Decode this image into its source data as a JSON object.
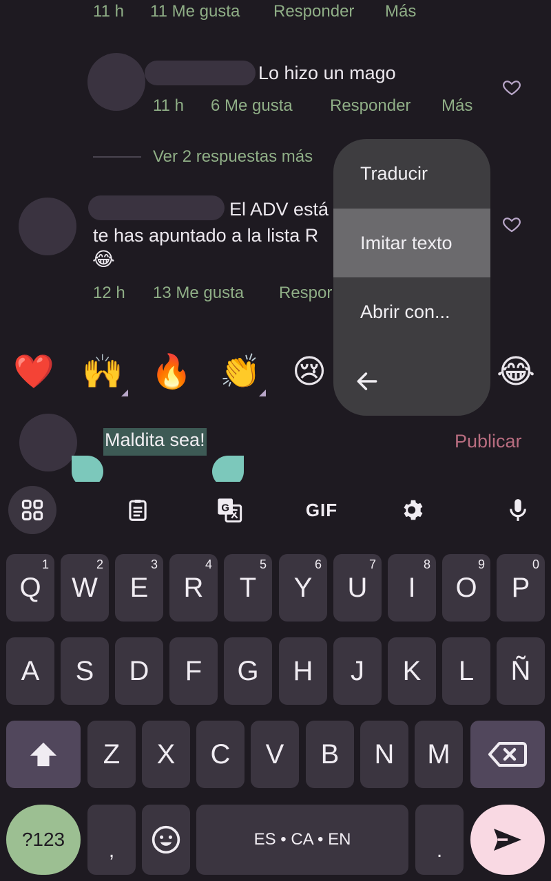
{
  "comments": [
    {
      "time": "11 h",
      "likes": "11 Me gusta",
      "reply": "Responder",
      "more": "Más"
    },
    {
      "text": "Lo hizo un mago",
      "time": "11 h",
      "likes": "6 Me gusta",
      "reply": "Responder",
      "more": "Más"
    },
    {
      "text_line1": "El ADV está",
      "text_line2": "te has apuntado a la lista R",
      "emoji": "😂",
      "time": "12 h",
      "likes": "13 Me gusta",
      "reply": "Respor"
    }
  ],
  "view_more_replies": "Ver 2 respuestas más",
  "context_menu": {
    "items": [
      "Traducir",
      "Imitar texto",
      "Abrir con..."
    ],
    "back_icon": "arrow-back-icon"
  },
  "emoji_bar": [
    "❤️",
    "🙌",
    "🔥",
    "👏",
    "😢",
    "😂"
  ],
  "input": {
    "selected_text": "Maldita sea!",
    "publish": "Publicar"
  },
  "keyboard": {
    "toolbar": [
      "apps-icon",
      "clipboard-icon",
      "translate-icon",
      "GIF",
      "gear-icon",
      "mic-icon"
    ],
    "gif_label": "GIF",
    "row1": [
      {
        "k": "Q",
        "n": "1"
      },
      {
        "k": "W",
        "n": "2"
      },
      {
        "k": "E",
        "n": "3"
      },
      {
        "k": "R",
        "n": "4"
      },
      {
        "k": "T",
        "n": "5"
      },
      {
        "k": "Y",
        "n": "6"
      },
      {
        "k": "U",
        "n": "7"
      },
      {
        "k": "I",
        "n": "8"
      },
      {
        "k": "O",
        "n": "9"
      },
      {
        "k": "P",
        "n": "0"
      }
    ],
    "row2": [
      "A",
      "S",
      "D",
      "F",
      "G",
      "H",
      "J",
      "K",
      "L",
      "Ñ"
    ],
    "row3": [
      "Z",
      "X",
      "C",
      "V",
      "B",
      "N",
      "M"
    ],
    "symbols": "?123",
    "comma": ",",
    "space": "ES • CA • EN",
    "period": ".",
    "colors": {
      "accent_green": "#8fae86",
      "send_bg": "#f9d9e3",
      "symbols_bg": "#9cbf92",
      "publish": "#b96d80"
    }
  }
}
